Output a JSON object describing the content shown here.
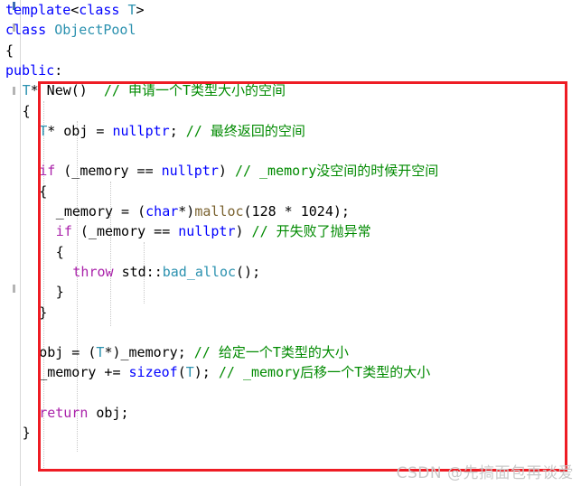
{
  "editor": {
    "language": "cpp",
    "colors": {
      "background": "#ffffff",
      "keyword": "#0000ff",
      "control_keyword": "#aa22aa",
      "type": "#2b91af",
      "function": "#7a6230",
      "comment": "#008a00",
      "plain_text": "#000000",
      "annotation_box": "#ee1c24",
      "watermark": "#c9c9c9",
      "gutter_line": "#d9d9d9",
      "indent_guide": "#c8c8c8",
      "change_bar": "#3d6eb4"
    },
    "lines": [
      {
        "indent": 0,
        "tokens": [
          {
            "t": "template",
            "c": "kw"
          },
          {
            "t": "<",
            "c": "txt"
          },
          {
            "t": "class",
            "c": "kw"
          },
          {
            "t": " ",
            "c": "txt"
          },
          {
            "t": "T",
            "c": "type"
          },
          {
            "t": ">",
            "c": "txt"
          }
        ]
      },
      {
        "indent": 0,
        "tokens": [
          {
            "t": "class",
            "c": "kw"
          },
          {
            "t": " ",
            "c": "txt"
          },
          {
            "t": "ObjectPool",
            "c": "type"
          }
        ]
      },
      {
        "indent": 0,
        "tokens": [
          {
            "t": "{",
            "c": "txt"
          }
        ]
      },
      {
        "indent": 0,
        "tokens": [
          {
            "t": "public",
            "c": "kw"
          },
          {
            "t": ":",
            "c": "txt"
          }
        ]
      },
      {
        "indent": 1,
        "tokens": [
          {
            "t": "T",
            "c": "type"
          },
          {
            "t": "* New()  ",
            "c": "txt"
          },
          {
            "t": "// 申请一个T类型大小的空间",
            "c": "cmt"
          }
        ]
      },
      {
        "indent": 1,
        "tokens": [
          {
            "t": "{",
            "c": "txt"
          }
        ]
      },
      {
        "indent": 2,
        "tokens": [
          {
            "t": "T",
            "c": "type"
          },
          {
            "t": "* obj = ",
            "c": "txt"
          },
          {
            "t": "nullptr",
            "c": "kw"
          },
          {
            "t": "; ",
            "c": "txt"
          },
          {
            "t": "// 最终返回的空间",
            "c": "cmt"
          }
        ]
      },
      {
        "indent": 0,
        "tokens": []
      },
      {
        "indent": 2,
        "tokens": [
          {
            "t": "if",
            "c": "ctl"
          },
          {
            "t": " (_memory == ",
            "c": "txt"
          },
          {
            "t": "nullptr",
            "c": "kw"
          },
          {
            "t": ") ",
            "c": "txt"
          },
          {
            "t": "// _memory没空间的时候开空间",
            "c": "cmt"
          }
        ]
      },
      {
        "indent": 2,
        "tokens": [
          {
            "t": "{",
            "c": "txt"
          }
        ]
      },
      {
        "indent": 3,
        "tokens": [
          {
            "t": "_memory = (",
            "c": "txt"
          },
          {
            "t": "char",
            "c": "kw"
          },
          {
            "t": "*)",
            "c": "txt"
          },
          {
            "t": "malloc",
            "c": "fn"
          },
          {
            "t": "(128 * 1024);",
            "c": "txt"
          }
        ]
      },
      {
        "indent": 3,
        "tokens": [
          {
            "t": "if",
            "c": "ctl"
          },
          {
            "t": " (_memory == ",
            "c": "txt"
          },
          {
            "t": "nullptr",
            "c": "kw"
          },
          {
            "t": ") ",
            "c": "txt"
          },
          {
            "t": "// 开失败了抛异常",
            "c": "cmt"
          }
        ]
      },
      {
        "indent": 3,
        "tokens": [
          {
            "t": "{",
            "c": "txt"
          }
        ]
      },
      {
        "indent": 4,
        "tokens": [
          {
            "t": "throw",
            "c": "ctl"
          },
          {
            "t": " std::",
            "c": "txt"
          },
          {
            "t": "bad_alloc",
            "c": "type"
          },
          {
            "t": "();",
            "c": "txt"
          }
        ]
      },
      {
        "indent": 3,
        "tokens": [
          {
            "t": "}",
            "c": "txt"
          }
        ]
      },
      {
        "indent": 2,
        "tokens": [
          {
            "t": "}",
            "c": "txt"
          }
        ]
      },
      {
        "indent": 0,
        "tokens": []
      },
      {
        "indent": 2,
        "tokens": [
          {
            "t": "obj = (",
            "c": "txt"
          },
          {
            "t": "T",
            "c": "type"
          },
          {
            "t": "*)_memory; ",
            "c": "txt"
          },
          {
            "t": "// 给定一个T类型的大小",
            "c": "cmt"
          }
        ]
      },
      {
        "indent": 2,
        "tokens": [
          {
            "t": "_memory += ",
            "c": "txt"
          },
          {
            "t": "sizeof",
            "c": "kw"
          },
          {
            "t": "(",
            "c": "txt"
          },
          {
            "t": "T",
            "c": "type"
          },
          {
            "t": "); ",
            "c": "txt"
          },
          {
            "t": "// _memory后移一个T类型的大小",
            "c": "cmt"
          }
        ]
      },
      {
        "indent": 0,
        "tokens": []
      },
      {
        "indent": 2,
        "tokens": [
          {
            "t": "return",
            "c": "ctl"
          },
          {
            "t": " obj;",
            "c": "txt"
          }
        ]
      },
      {
        "indent": 1,
        "tokens": [
          {
            "t": "}",
            "c": "txt"
          }
        ]
      }
    ]
  },
  "watermark": {
    "text": "CSDN @先搞面包再谈爱"
  }
}
